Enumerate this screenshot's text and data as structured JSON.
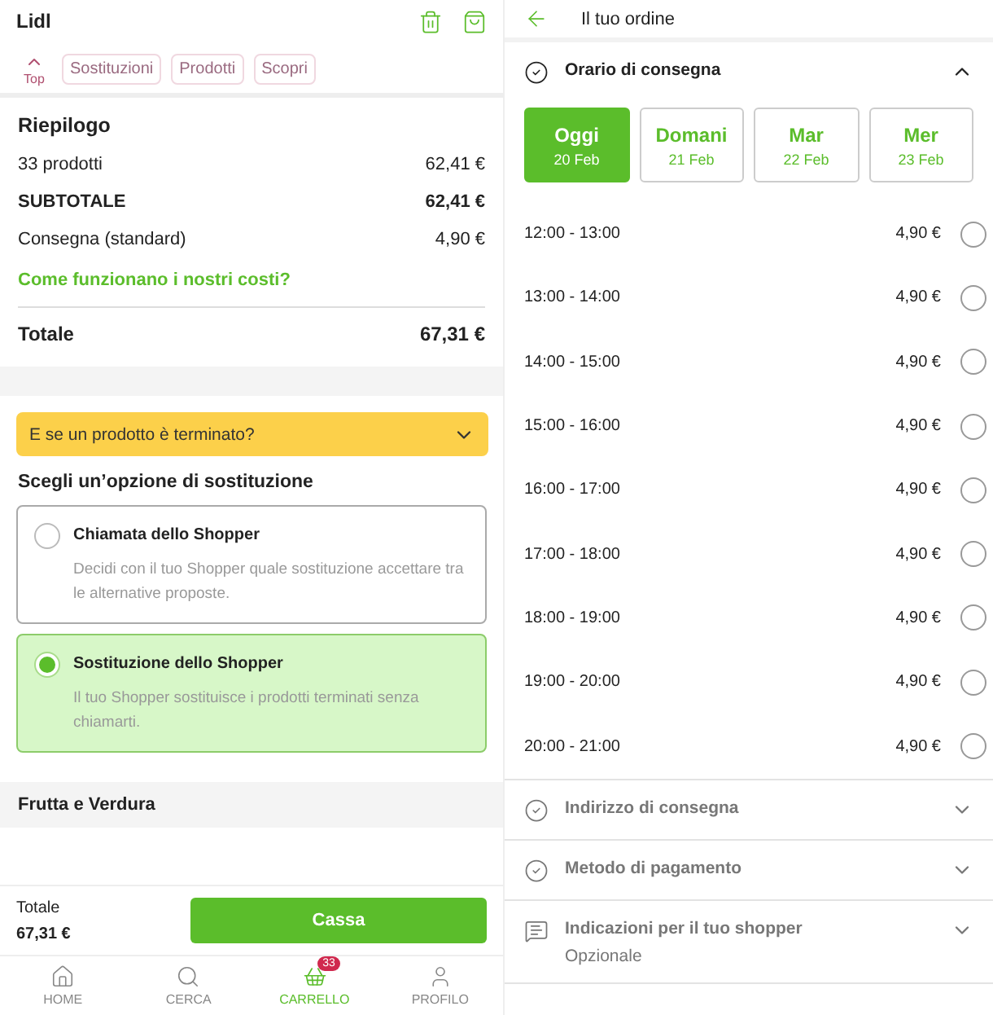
{
  "cart": {
    "store": "Lidl",
    "top_label": "Top",
    "chips": [
      "Sostituzioni",
      "Prodotti",
      "Scopri"
    ],
    "summary": {
      "title": "Riepilogo",
      "lines": [
        {
          "label": "33 prodotti",
          "value": "62,41 €",
          "bold": false
        },
        {
          "label": "SUBTOTALE",
          "value": "62,41 €",
          "bold": true
        },
        {
          "label": "Consegna (standard)",
          "value": "4,90 €",
          "bold": false
        }
      ],
      "link": "Come funzionano i nostri costi?",
      "total_label": "Totale",
      "total_value": "67,31 €"
    },
    "out_of_stock": {
      "question": "E se un prodotto è terminato?",
      "heading": "Scegli un’opzione di sostituzione",
      "options": [
        {
          "title": "Chiamata dello Shopper",
          "description": "Decidi con il tuo Shopper quale sostituzione accettare tra le alternative proposte.",
          "selected": false
        },
        {
          "title": "Sostituzione dello Shopper",
          "description": "Il tuo Shopper sostituisce i prodotti terminati senza chiamarti.",
          "selected": true
        }
      ]
    },
    "category": "Frutta e Verdura",
    "footer": {
      "total_label": "Totale",
      "total_value": "67,31 €",
      "checkout": "Cassa"
    },
    "nav": [
      {
        "label": "HOME",
        "kind": "home",
        "selected": false
      },
      {
        "label": "CERCA",
        "kind": "search",
        "selected": false
      },
      {
        "label": "CARRELLO",
        "kind": "basket",
        "badge": "33",
        "selected": true
      },
      {
        "label": "PROFILO",
        "kind": "user",
        "selected": false
      }
    ]
  },
  "order": {
    "title": "Il tuo ordine",
    "delivery_time": {
      "title": "Orario di consegna",
      "expanded": true,
      "days": [
        {
          "day": "Oggi",
          "date": "20 Feb",
          "selected": true
        },
        {
          "day": "Domani",
          "date": "21 Feb",
          "selected": false
        },
        {
          "day": "Mar",
          "date": "22 Feb",
          "selected": false
        },
        {
          "day": "Mer",
          "date": "23 Feb",
          "selected": false
        }
      ],
      "slots": [
        {
          "time": "12:00 - 13:00",
          "price": "4,90 €",
          "selected": false
        },
        {
          "time": "13:00 - 14:00",
          "price": "4,90 €",
          "selected": false
        },
        {
          "time": "14:00 - 15:00",
          "price": "4,90 €",
          "selected": false
        },
        {
          "time": "15:00 - 16:00",
          "price": "4,90 €",
          "selected": false
        },
        {
          "time": "16:00 - 17:00",
          "price": "4,90 €",
          "selected": false
        },
        {
          "time": "17:00 - 18:00",
          "price": "4,90 €",
          "selected": false
        },
        {
          "time": "18:00 - 19:00",
          "price": "4,90 €",
          "selected": false
        },
        {
          "time": "19:00 - 20:00",
          "price": "4,90 €",
          "selected": false
        },
        {
          "time": "20:00 - 21:00",
          "price": "4,90 €",
          "selected": false
        }
      ]
    },
    "sections": [
      {
        "title": "Indirizzo di consegna",
        "kind": "check",
        "expanded": false
      },
      {
        "title": "Metodo di pagamento",
        "kind": "check",
        "expanded": false
      },
      {
        "title": "Indicazioni per il tuo shopper",
        "subtitle": "Opzionale",
        "kind": "note",
        "expanded": false
      }
    ]
  }
}
